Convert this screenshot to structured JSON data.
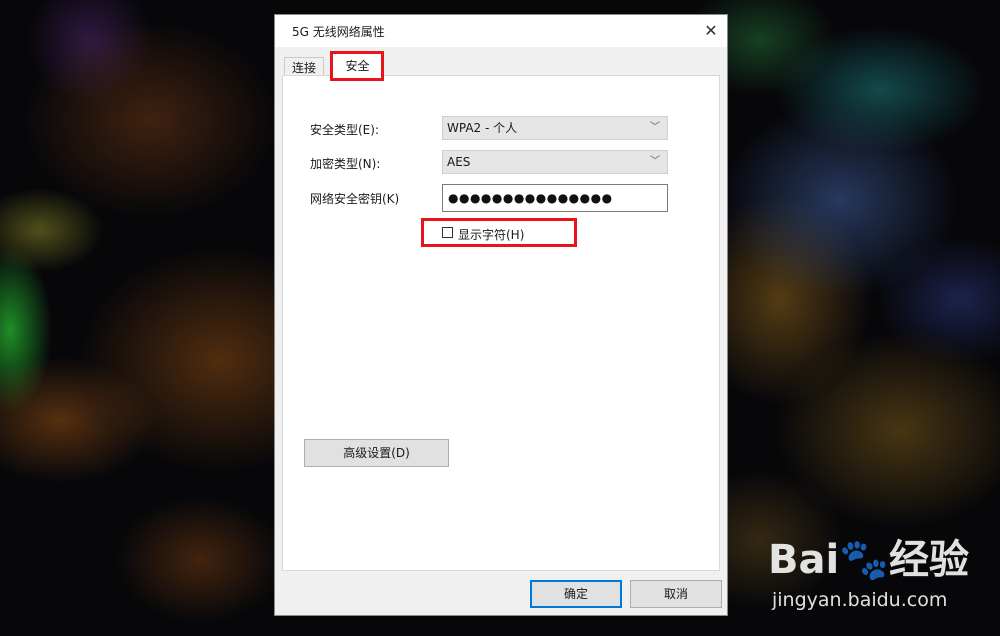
{
  "window": {
    "title": "5G 无线网络属性",
    "close_glyph": "✕"
  },
  "tabs": [
    {
      "label": "连接",
      "active": false
    },
    {
      "label": "安全",
      "active": true
    }
  ],
  "security": {
    "type_label": "安全类型(E):",
    "type_value": "WPA2 - 个人",
    "encryption_label": "加密类型(N):",
    "encryption_value": "AES",
    "key_label": "网络安全密钥(K)",
    "key_value": "●●●●●●●●●●●●●●●",
    "show_chars_label": "显示字符(H)",
    "show_chars_checked": false,
    "chevron_glyph": "﹀"
  },
  "buttons": {
    "advanced": "高级设置(D)",
    "ok": "确定",
    "cancel": "取消"
  },
  "watermark": {
    "brand": "Bai🐾经验",
    "url": "jingyan.baidu.com"
  },
  "colors": {
    "highlight": "#e8141c",
    "ok_focus": "#0078d7"
  }
}
